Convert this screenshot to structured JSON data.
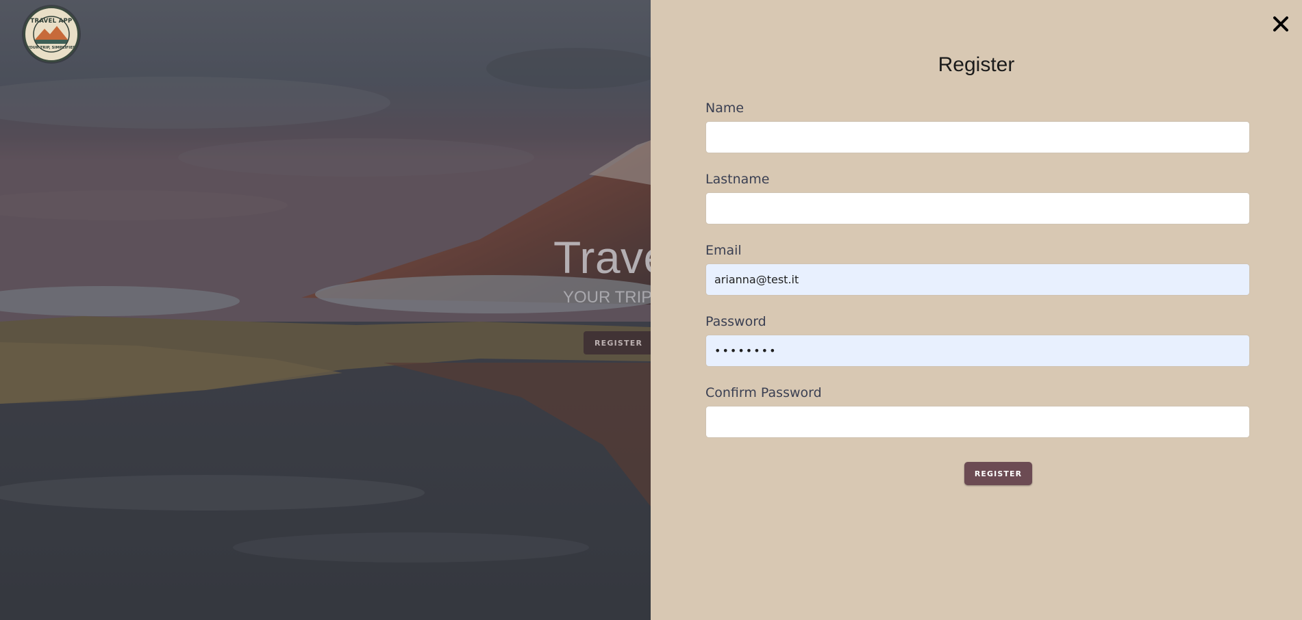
{
  "hero": {
    "title": "Trave",
    "subtitle": "YOUR TRIP,",
    "register_label": "REGISTER"
  },
  "logo": {
    "top_text": "TRAVEL APP",
    "bottom_text": "YOUR TRIP, SIMPLIFIED"
  },
  "panel": {
    "title": "Register",
    "close_icon": "close-icon",
    "fields": [
      {
        "label": "Name",
        "value": ""
      },
      {
        "label": "Lastname",
        "value": ""
      },
      {
        "label": "Email",
        "value": "arianna@test.it"
      },
      {
        "label": "Password",
        "value": "••••••••"
      },
      {
        "label": "Confirm Password",
        "value": ""
      }
    ],
    "submit_label": "REGISTER"
  },
  "colors": {
    "panel_background": "#d8c8b3",
    "button_background": "#6c4b53",
    "autofill_background": "#e8f0fe",
    "label_color": "#3a3f52"
  }
}
